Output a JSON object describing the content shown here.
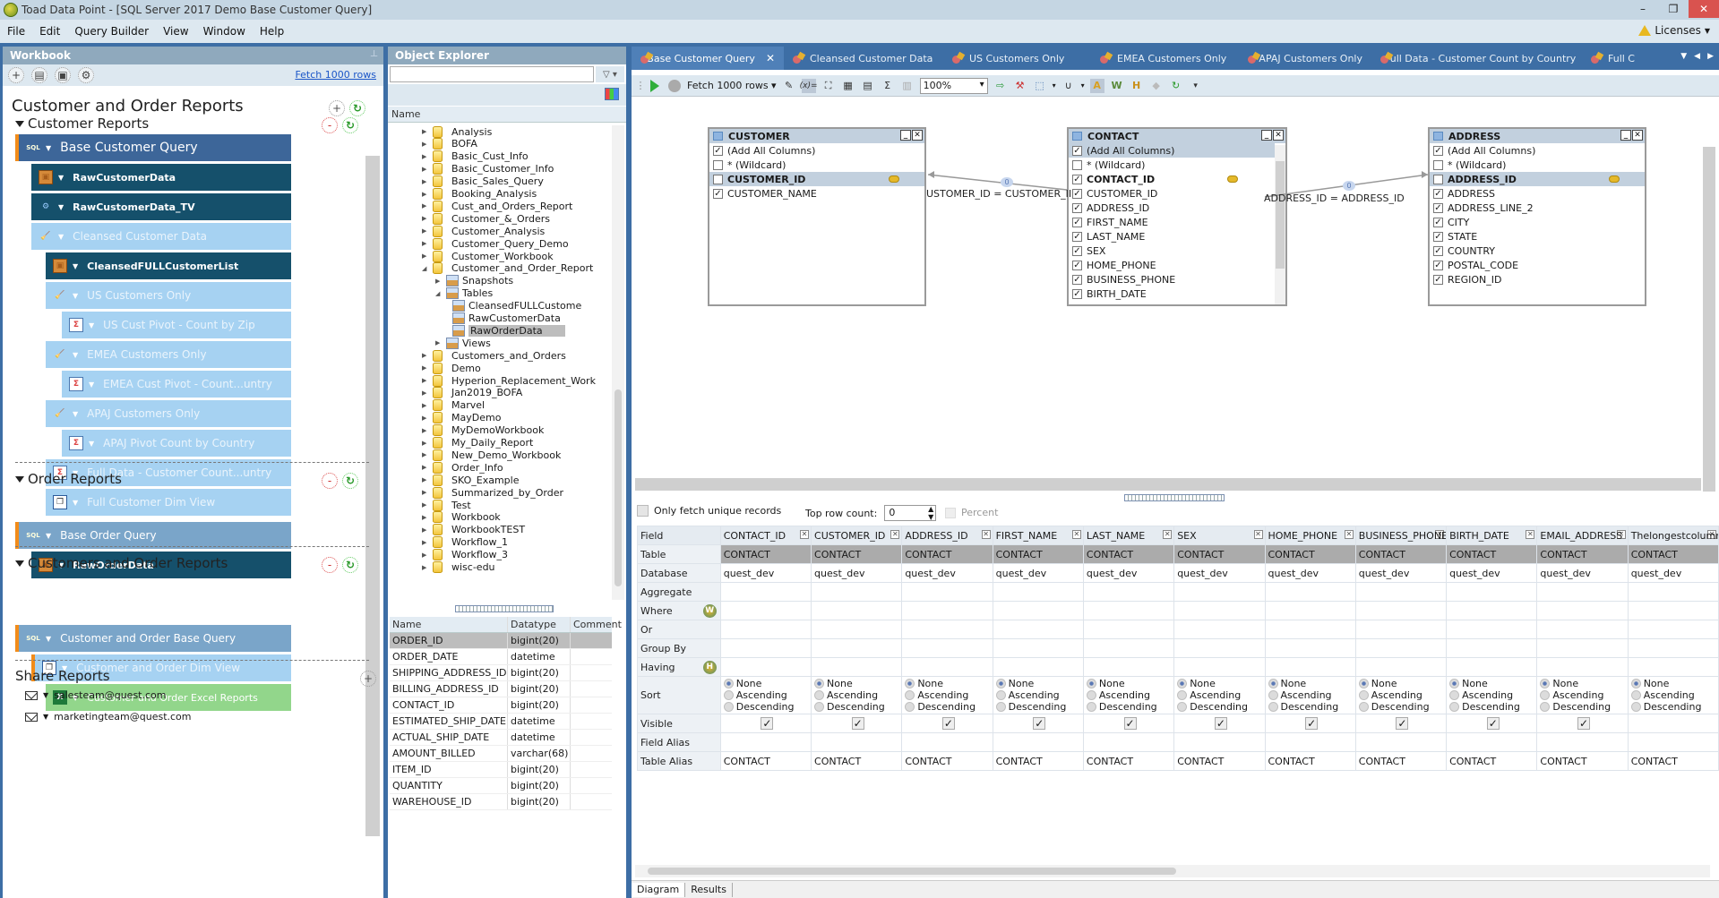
{
  "window": {
    "title": "Toad Data Point - [SQL Server 2017 Demo Base Customer Query]",
    "licenses_label": "Licenses"
  },
  "menu": [
    "File",
    "Edit",
    "Query Builder",
    "View",
    "Window",
    "Help"
  ],
  "workbook": {
    "header": "Workbook",
    "fetch_link": "Fetch 1000 rows",
    "title": "Customer and Order Reports",
    "sections": [
      {
        "label": "Customer Reports",
        "nodes": [
          {
            "label": "Base Customer Query",
            "type": "sql",
            "icon": "sql-query-icon"
          },
          {
            "label": "RawCustomerData",
            "type": "dark",
            "icon": "table-icon"
          },
          {
            "label": "RawCustomerData_TV",
            "type": "dark",
            "icon": "transform-icon"
          },
          {
            "label": "Cleansed Customer Data",
            "type": "light",
            "icon": "broom-icon"
          },
          {
            "label": "CleansedFULLCustomerList",
            "type": "dark",
            "icon": "table-icon"
          },
          {
            "label": "US Customers Only",
            "type": "light",
            "icon": "broom-icon"
          },
          {
            "label": "US Cust Pivot - Count by Zip",
            "type": "light",
            "icon": "pivot-icon"
          },
          {
            "label": "EMEA Customers Only",
            "type": "light",
            "icon": "broom-icon"
          },
          {
            "label": "EMEA Cust Pivot - Count...untry",
            "type": "light",
            "icon": "pivot-icon"
          },
          {
            "label": "APAJ Customers Only",
            "type": "light",
            "icon": "broom-icon"
          },
          {
            "label": "APAJ Pivot Count by Country",
            "type": "light",
            "icon": "pivot-icon"
          },
          {
            "label": "Full Data - Customer Count...untry",
            "type": "light",
            "icon": "pivot-icon"
          },
          {
            "label": "Full Customer Dim View",
            "type": "light",
            "icon": "dim-view-icon"
          }
        ]
      },
      {
        "label": "Order Reports",
        "nodes": [
          {
            "label": "Base Order Query",
            "type": "sql2",
            "icon": "sql-query-icon"
          },
          {
            "label": "RawOrderData",
            "type": "dark",
            "icon": "table-icon"
          }
        ]
      },
      {
        "label": "Customers and Order Reports",
        "nodes": [
          {
            "label": "Customer and Order Base Query",
            "type": "sql2",
            "icon": "sql-query-icon"
          },
          {
            "label": "Customer and Order Dim View",
            "type": "light",
            "icon": "dim-view-icon"
          },
          {
            "label": "Customer and Order Excel Reports",
            "type": "green",
            "icon": "excel-icon"
          }
        ]
      }
    ],
    "share": {
      "label": "Share Reports",
      "recipients": [
        "salesteam@quest.com",
        "marketingteam@quest.com"
      ]
    }
  },
  "object_explorer": {
    "header": "Object Explorer",
    "search_value": "",
    "column_header": "Name",
    "tree": [
      {
        "label": "Analysis",
        "kind": "db",
        "level": 0,
        "expanded": false
      },
      {
        "label": "BOFA",
        "kind": "db",
        "level": 0,
        "expanded": false
      },
      {
        "label": "Basic_Cust_Info",
        "kind": "db",
        "level": 0,
        "expanded": false
      },
      {
        "label": "Basic_Customer_Info",
        "kind": "db",
        "level": 0,
        "expanded": false
      },
      {
        "label": "Basic_Sales_Query",
        "kind": "db",
        "level": 0,
        "expanded": false
      },
      {
        "label": "Booking_Analysis",
        "kind": "db",
        "level": 0,
        "expanded": false
      },
      {
        "label": "Cust_and_Orders_Report",
        "kind": "db",
        "level": 0,
        "expanded": false
      },
      {
        "label": "Customer_&_Orders",
        "kind": "db",
        "level": 0,
        "expanded": false
      },
      {
        "label": "Customer_Analysis",
        "kind": "db",
        "level": 0,
        "expanded": false
      },
      {
        "label": "Customer_Query_Demo",
        "kind": "db",
        "level": 0,
        "expanded": false
      },
      {
        "label": "Customer_Workbook",
        "kind": "db",
        "level": 0,
        "expanded": false
      },
      {
        "label": "Customer_and_Order_Report",
        "kind": "db",
        "level": 0,
        "expanded": true
      },
      {
        "label": "Snapshots",
        "kind": "folder",
        "level": 1,
        "expanded": false
      },
      {
        "label": "Tables",
        "kind": "folder",
        "level": 1,
        "expanded": true
      },
      {
        "label": "CleansedFULLCustome",
        "kind": "table",
        "level": 2
      },
      {
        "label": "RawCustomerData",
        "kind": "table",
        "level": 2
      },
      {
        "label": "RawOrderData",
        "kind": "table",
        "level": 2,
        "selected": true
      },
      {
        "label": "Views",
        "kind": "folder",
        "level": 1,
        "expanded": false
      },
      {
        "label": "Customers_and_Orders",
        "kind": "db",
        "level": 0,
        "expanded": false
      },
      {
        "label": "Demo",
        "kind": "db",
        "level": 0,
        "expanded": false
      },
      {
        "label": "Hyperion_Replacement_Work",
        "kind": "db",
        "level": 0,
        "expanded": false
      },
      {
        "label": "Jan2019_BOFA",
        "kind": "db",
        "level": 0,
        "expanded": false
      },
      {
        "label": "Marvel",
        "kind": "db",
        "level": 0,
        "expanded": false
      },
      {
        "label": "MayDemo",
        "kind": "db",
        "level": 0,
        "expanded": false
      },
      {
        "label": "MyDemoWorkbook",
        "kind": "db",
        "level": 0,
        "expanded": false
      },
      {
        "label": "My_Daily_Report",
        "kind": "db",
        "level": 0,
        "expanded": false
      },
      {
        "label": "New_Demo_Workbook",
        "kind": "db",
        "level": 0,
        "expanded": false
      },
      {
        "label": "Order_Info",
        "kind": "db",
        "level": 0,
        "expanded": false
      },
      {
        "label": "SKO_Example",
        "kind": "db",
        "level": 0,
        "expanded": false
      },
      {
        "label": "Summarized_by_Order",
        "kind": "db",
        "level": 0,
        "expanded": false
      },
      {
        "label": "Test",
        "kind": "db",
        "level": 0,
        "expanded": false
      },
      {
        "label": "Workbook",
        "kind": "db",
        "level": 0,
        "expanded": false
      },
      {
        "label": "WorkbookTEST",
        "kind": "db",
        "level": 0,
        "expanded": false
      },
      {
        "label": "Workflow_1",
        "kind": "db",
        "level": 0,
        "expanded": false
      },
      {
        "label": "Workflow_3",
        "kind": "db",
        "level": 0,
        "expanded": false
      },
      {
        "label": "wisc-edu",
        "kind": "db",
        "level": 0,
        "expanded": false
      }
    ],
    "columns_table": {
      "headers": [
        "Name",
        "Datatype",
        "Comment"
      ],
      "rows": [
        [
          "ORDER_ID",
          "bigint(20)",
          ""
        ],
        [
          "ORDER_DATE",
          "datetime",
          ""
        ],
        [
          "SHIPPING_ADDRESS_ID",
          "bigint(20)",
          ""
        ],
        [
          "BILLING_ADDRESS_ID",
          "bigint(20)",
          ""
        ],
        [
          "CONTACT_ID",
          "bigint(20)",
          ""
        ],
        [
          "ESTIMATED_SHIP_DATE",
          "datetime",
          ""
        ],
        [
          "ACTUAL_SHIP_DATE",
          "datetime",
          ""
        ],
        [
          "AMOUNT_BILLED",
          "varchar(68)",
          ""
        ],
        [
          "ITEM_ID",
          "bigint(20)",
          ""
        ],
        [
          "QUANTITY",
          "bigint(20)",
          ""
        ],
        [
          "WAREHOUSE_ID",
          "bigint(20)",
          ""
        ]
      ]
    }
  },
  "editor": {
    "tabs": [
      {
        "label": "Base Customer Query",
        "active": true
      },
      {
        "label": "Cleansed Customer Data"
      },
      {
        "label": "US Customers Only"
      },
      {
        "label": "EMEA Customers Only"
      },
      {
        "label": "APAJ Customers Only"
      },
      {
        "label": "Full Data - Customer Count by Country"
      },
      {
        "label": "Full C"
      }
    ],
    "toolbar": {
      "fetch_label": "Fetch 1000 rows",
      "zoom_value": "100%"
    },
    "diagram": {
      "tables": [
        {
          "name": "CUSTOMER",
          "rows": [
            {
              "label": "(Add All Columns)",
              "checked": true
            },
            {
              "label": "* (Wildcard)",
              "checked": false
            },
            {
              "label": "CUSTOMER_ID",
              "checked": false,
              "key": true,
              "highlight": true
            },
            {
              "label": "CUSTOMER_NAME",
              "checked": true
            }
          ]
        },
        {
          "name": "CONTACT",
          "rows": [
            {
              "label": "(Add All Columns)",
              "checked": true,
              "highlight": true
            },
            {
              "label": "* (Wildcard)",
              "checked": false
            },
            {
              "label": "CONTACT_ID",
              "checked": true,
              "key": true
            },
            {
              "label": "CUSTOMER_ID",
              "checked": true
            },
            {
              "label": "ADDRESS_ID",
              "checked": true
            },
            {
              "label": "FIRST_NAME",
              "checked": true
            },
            {
              "label": "LAST_NAME",
              "checked": true
            },
            {
              "label": "SEX",
              "checked": true
            },
            {
              "label": "HOME_PHONE",
              "checked": true
            },
            {
              "label": "BUSINESS_PHONE",
              "checked": true
            },
            {
              "label": "BIRTH_DATE",
              "checked": true
            }
          ]
        },
        {
          "name": "ADDRESS",
          "rows": [
            {
              "label": "(Add All Columns)",
              "checked": true
            },
            {
              "label": "* (Wildcard)",
              "checked": false
            },
            {
              "label": "ADDRESS_ID",
              "checked": false,
              "key": true,
              "highlight": true
            },
            {
              "label": "ADDRESS",
              "checked": true
            },
            {
              "label": "ADDRESS_LINE_2",
              "checked": true
            },
            {
              "label": "CITY",
              "checked": true
            },
            {
              "label": "STATE",
              "checked": true
            },
            {
              "label": "COUNTRY",
              "checked": true
            },
            {
              "label": "POSTAL_CODE",
              "checked": true
            },
            {
              "label": "REGION_ID",
              "checked": true
            }
          ]
        }
      ],
      "joins": [
        {
          "label": "USTOMER_ID = CUSTOMER_II",
          "count": "0"
        },
        {
          "label": "ADDRESS_ID = ADDRESS_ID",
          "count": "0"
        }
      ]
    },
    "options": {
      "unique_label": "Only fetch unique records",
      "top_row_label": "Top row count:",
      "top_row_value": "0",
      "percent_label": "Percent"
    },
    "grid": {
      "row_labels": [
        "Field",
        "Table",
        "Database",
        "Aggregate",
        "Where",
        "Or",
        "Group By",
        "Having",
        "Sort",
        "Visible",
        "Field Alias",
        "Table Alias"
      ],
      "sort_options": [
        "None",
        "Ascending",
        "Descending"
      ],
      "columns": [
        {
          "field": "CONTACT_ID",
          "table": "CONTACT",
          "database": "quest_dev",
          "sort": "None",
          "visible": true,
          "table_alias": "CONTACT"
        },
        {
          "field": "CUSTOMER_ID",
          "table": "CONTACT",
          "database": "quest_dev",
          "sort": "None",
          "visible": true,
          "table_alias": "CONTACT"
        },
        {
          "field": "ADDRESS_ID",
          "table": "CONTACT",
          "database": "quest_dev",
          "sort": "None",
          "visible": true,
          "table_alias": "CONTACT"
        },
        {
          "field": "FIRST_NAME",
          "table": "CONTACT",
          "database": "quest_dev",
          "sort": "None",
          "visible": true,
          "table_alias": "CONTACT"
        },
        {
          "field": "LAST_NAME",
          "table": "CONTACT",
          "database": "quest_dev",
          "sort": "None",
          "visible": true,
          "table_alias": "CONTACT"
        },
        {
          "field": "SEX",
          "table": "CONTACT",
          "database": "quest_dev",
          "sort": "None",
          "visible": true,
          "table_alias": "CONTACT"
        },
        {
          "field": "HOME_PHONE",
          "table": "CONTACT",
          "database": "quest_dev",
          "sort": "None",
          "visible": true,
          "table_alias": "CONTACT"
        },
        {
          "field": "BUSINESS_PHONE",
          "table": "CONTACT",
          "database": "quest_dev",
          "sort": "None",
          "visible": true,
          "table_alias": "CONTACT"
        },
        {
          "field": "BIRTH_DATE",
          "table": "CONTACT",
          "database": "quest_dev",
          "sort": "None",
          "visible": true,
          "table_alias": "CONTACT"
        },
        {
          "field": "EMAIL_ADDRESS",
          "table": "CONTACT",
          "database": "quest_dev",
          "sort": "None",
          "visible": true,
          "table_alias": "CONTACT"
        },
        {
          "field": "Thelongestcolumnnan",
          "table": "CONTACT",
          "database": "quest_dev",
          "sort": "None",
          "visible": false,
          "table_alias": "CONTACT"
        }
      ]
    },
    "bottom_tabs": [
      "Diagram",
      "Results"
    ]
  }
}
